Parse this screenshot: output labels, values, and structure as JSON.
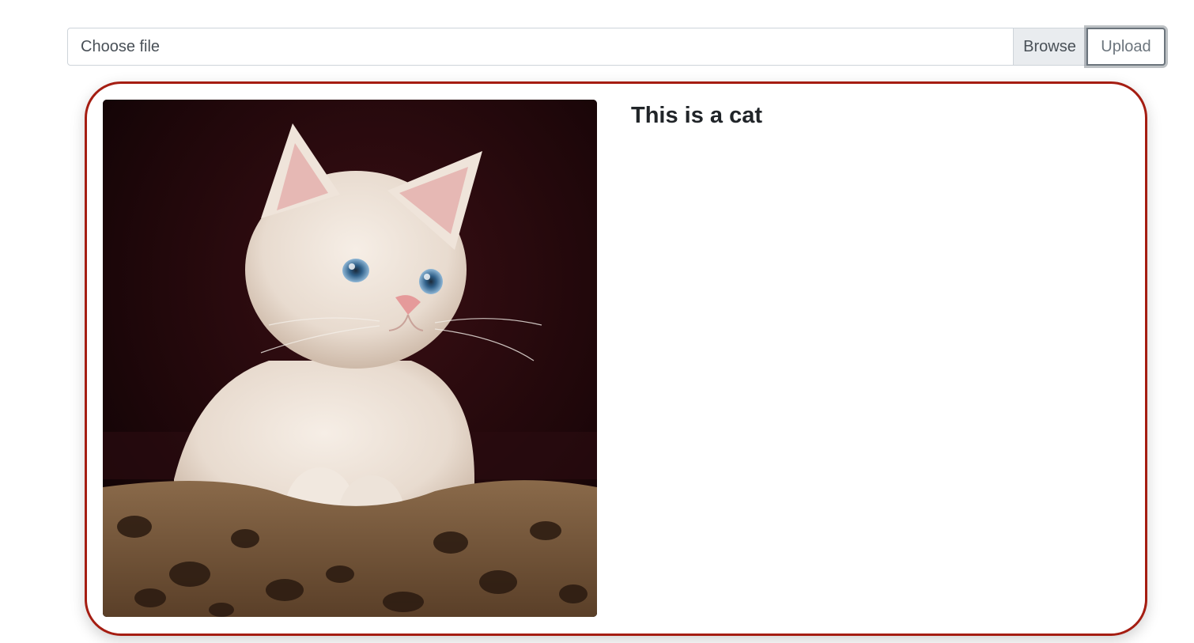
{
  "upload_form": {
    "file_placeholder": "Choose file",
    "browse_label": "Browse",
    "upload_label": "Upload"
  },
  "result_card": {
    "title": "This is a cat",
    "image_icon": "kitten-photo",
    "border_color": "#a51d12"
  }
}
